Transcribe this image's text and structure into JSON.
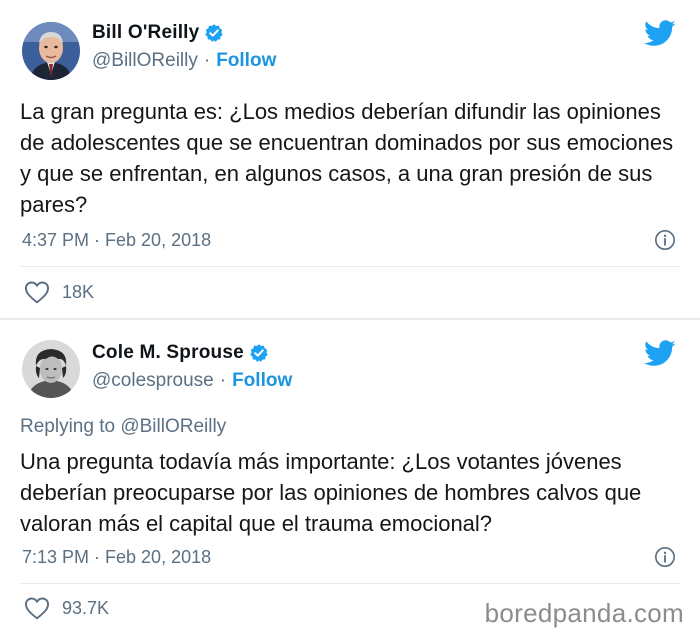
{
  "tweets": [
    {
      "name": "Bill O'Reilly",
      "handle": "@BillOReilly",
      "separator": "·",
      "follow": "Follow",
      "text": "La gran pregunta es: ¿Los medios deberían difundir las opiniones de adolescentes que se encuentran dominados por sus emociones y que se enfrentan, en algunos casos, a una gran presión de sus pares?",
      "time": "4:37 PM · Feb 20, 2018",
      "likes": "18K"
    },
    {
      "name": "Cole M. Sprouse",
      "handle": "@colesprouse",
      "separator": "·",
      "follow": "Follow",
      "replying": "Replying to @BillOReilly",
      "text": "Una pregunta todavía más importante: ¿Los votantes jóvenes deberían preocuparse por las opiniones de hombres calvos que valoran más el capital que el trauma emocional?",
      "time": "7:13 PM · Feb 20, 2018",
      "likes": "93.7K"
    }
  ],
  "watermark": "boredpanda.com",
  "colors": {
    "twitter_blue": "#1da1f2",
    "link_blue": "#1b95e0",
    "secondary_text": "#5b7083",
    "verified_badge": "#1da1f2"
  },
  "icons": [
    "twitter-bird-icon",
    "verified-badge-icon",
    "info-icon",
    "heart-icon"
  ]
}
